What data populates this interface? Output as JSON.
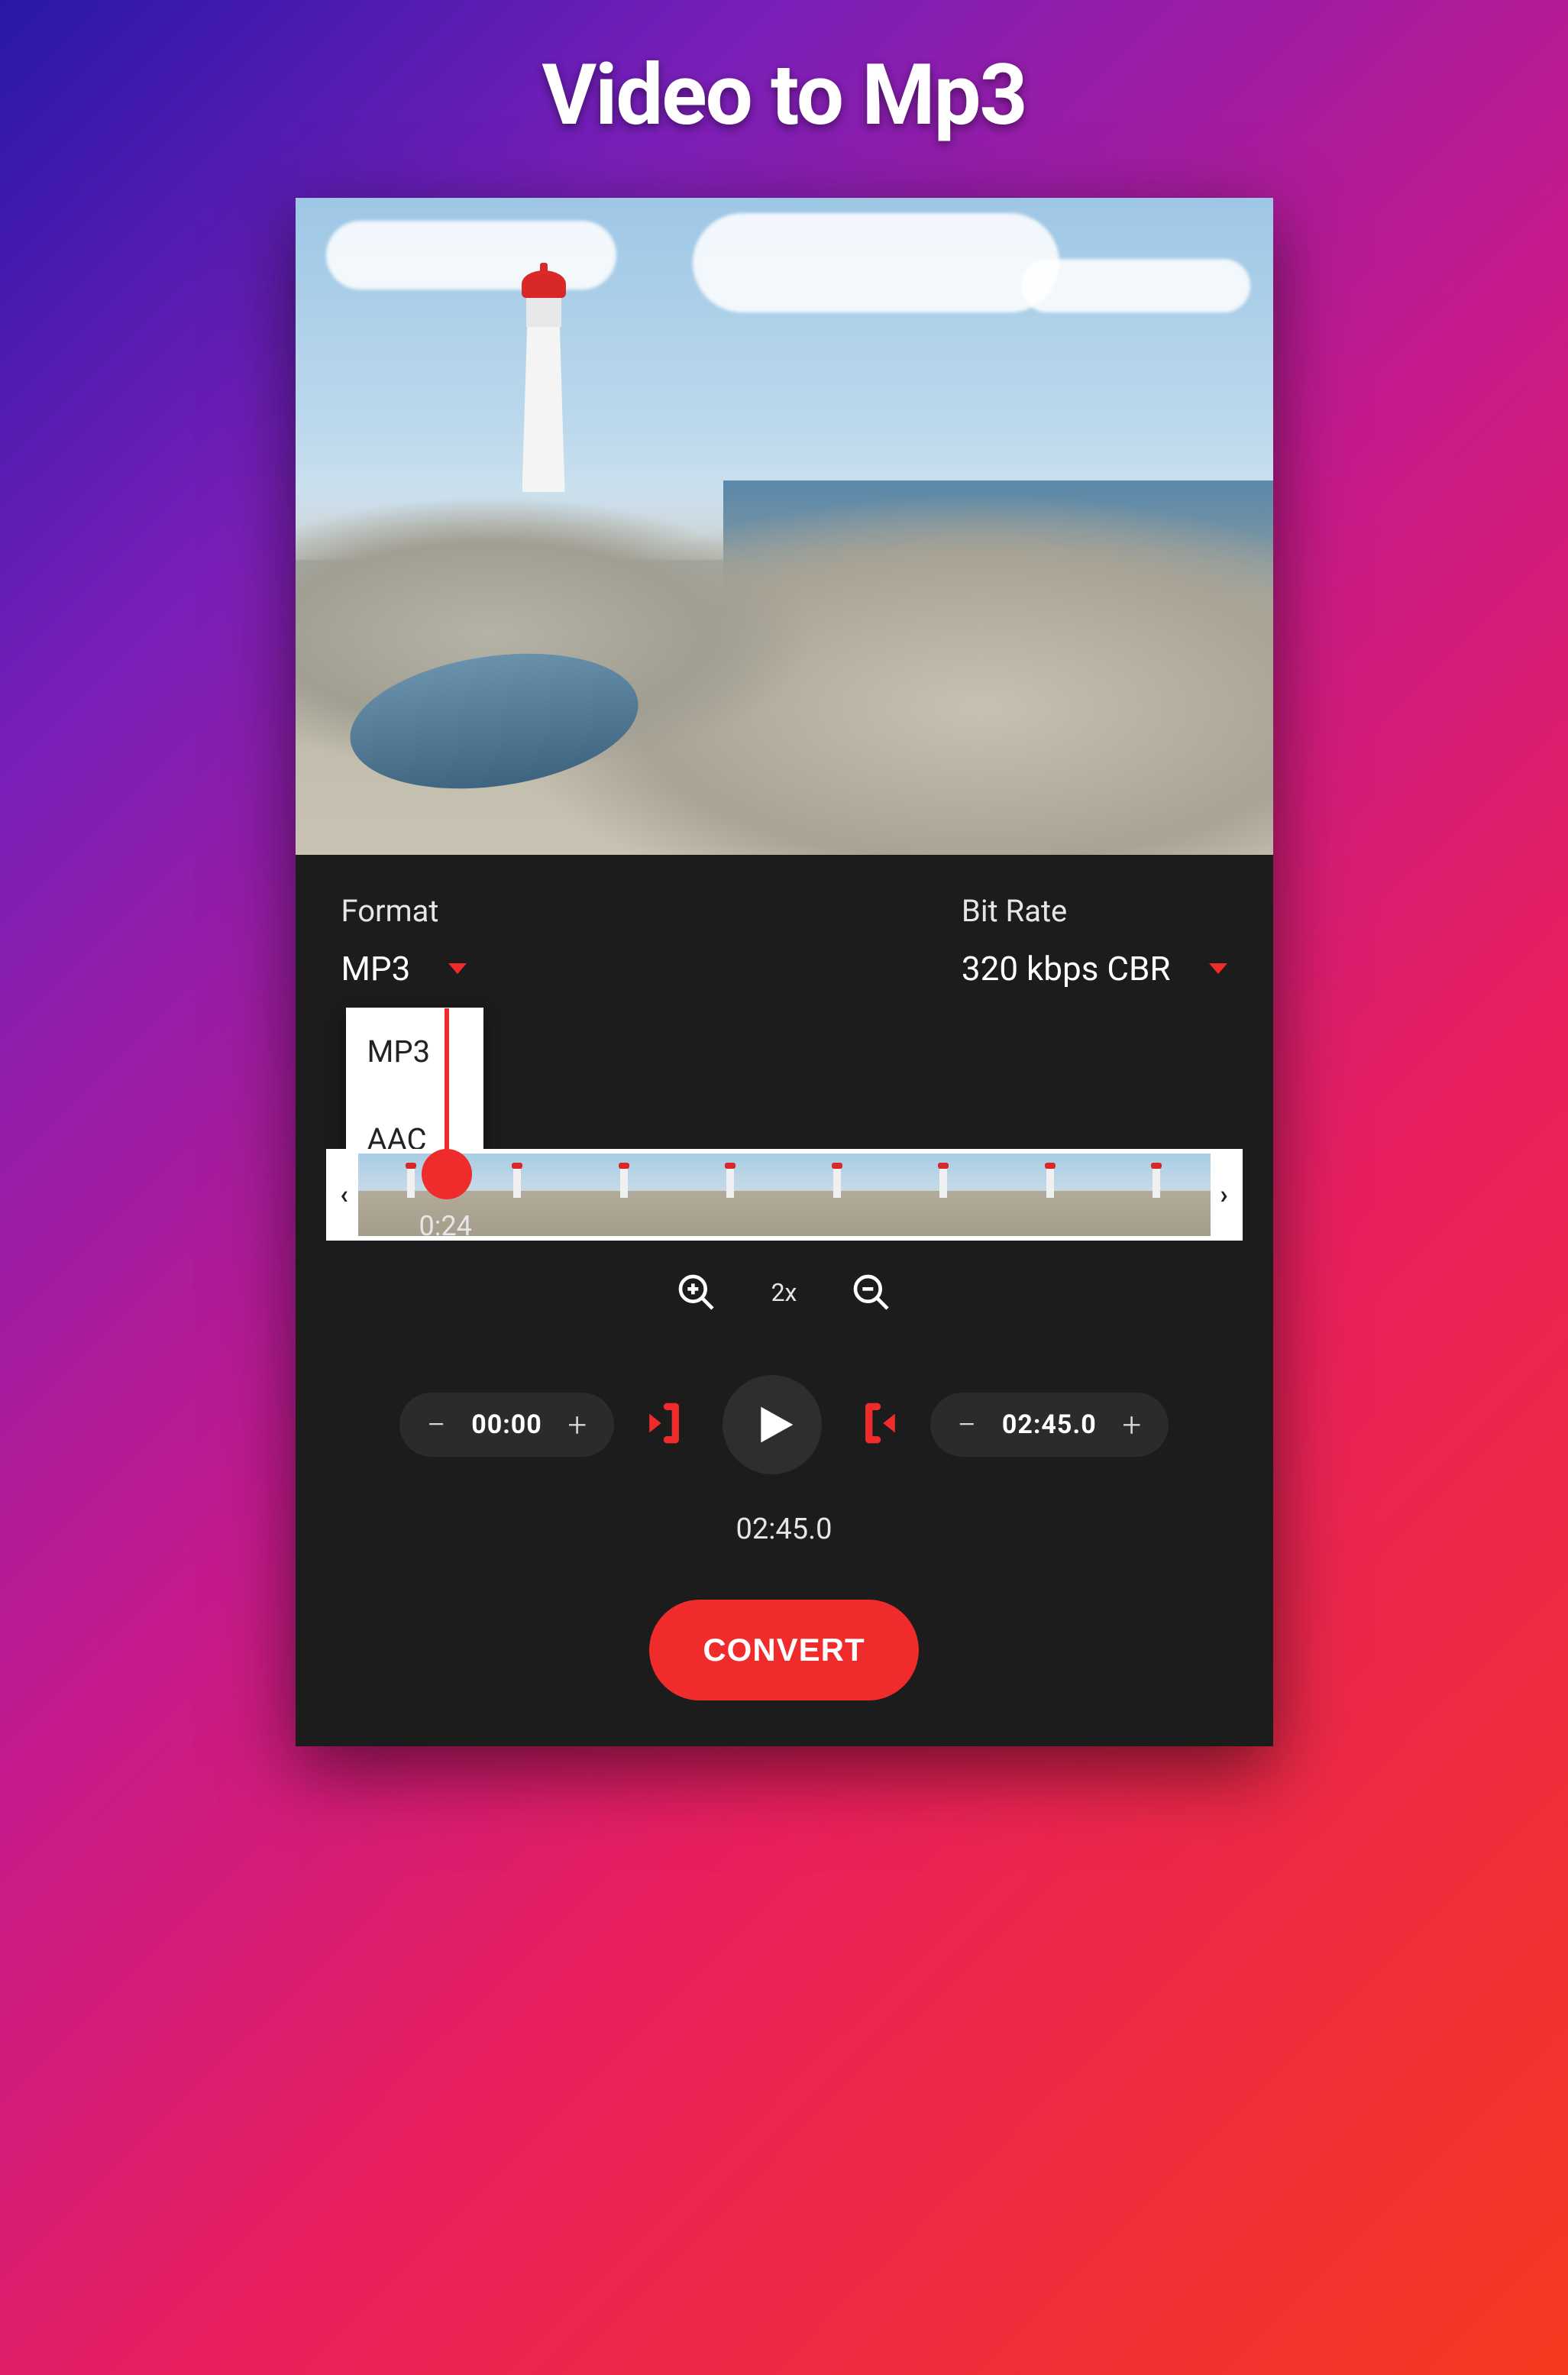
{
  "hero": {
    "title": "Video to Mp3"
  },
  "settings": {
    "format": {
      "label": "Format",
      "value": "MP3",
      "options": [
        "MP3",
        "AAC"
      ]
    },
    "bitrate": {
      "label": "Bit Rate",
      "value": "320 kbps CBR"
    }
  },
  "timeline": {
    "playhead_time": "0:24",
    "zoom_level": "2x",
    "thumb_count": 8
  },
  "controls": {
    "start_time": "00:00",
    "end_time": "02:45.0",
    "duration": "02:45.0"
  },
  "action": {
    "convert_label": "CONVERT"
  }
}
